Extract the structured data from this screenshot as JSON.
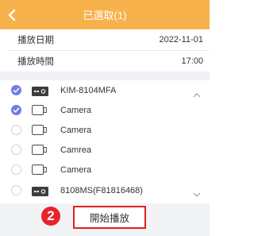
{
  "header": {
    "title": "已選取(1)"
  },
  "info": {
    "date_label": "播放日期",
    "date_value": "2022-11-01",
    "time_label": "播放時間",
    "time_value": "17:00"
  },
  "devices": [
    {
      "label": "KIM-8104MFA",
      "checked": true,
      "icon": "dvr-icon",
      "chevron": "chevron-up-icon"
    },
    {
      "label": "Camera",
      "checked": true,
      "icon": "camera-icon"
    },
    {
      "label": "Camera",
      "checked": false,
      "icon": "camera-icon"
    },
    {
      "label": "Camrea",
      "checked": false,
      "icon": "camera-icon"
    },
    {
      "label": "Camera",
      "checked": false,
      "icon": "camera-icon"
    },
    {
      "label": "8108MS(F81816468)",
      "checked": false,
      "icon": "dvr-icon",
      "chevron": "chevron-down-icon"
    }
  ],
  "footer": {
    "badge": "2",
    "play_label": "開始播放"
  },
  "colors": {
    "header": "#f7b24c",
    "checked": "#6f7ee8",
    "badge": "#e8232a",
    "button_border": "#e02020"
  }
}
